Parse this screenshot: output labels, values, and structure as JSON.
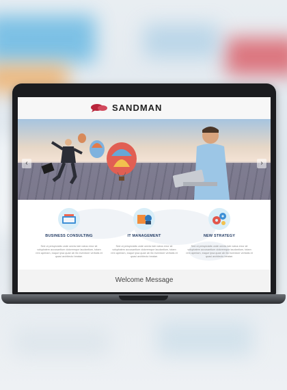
{
  "site": {
    "brand": "SANDMAN",
    "hero": {
      "prev_arrow": "‹",
      "next_arrow": "›"
    },
    "features": [
      {
        "title": "BUSINESS CONSULTING",
        "text": "Sed ut perspiciatis unde omnis iste natus error sit voluptatem accusantium doloremque laudantium, totam rem aperiam, eaque ipsa quae ab illo inventore veritatis et quasi architecto beatae."
      },
      {
        "title": "IT MANAGEMENT",
        "text": "Sed ut perspiciatis unde omnis iste natus error sit voluptatem accusantium doloremque laudantium, totam rem aperiam, eaque ipsa quae ab illo inventore veritatis et quasi architecto beatae."
      },
      {
        "title": "NEW STRATEGY",
        "text": "Sed ut perspiciatis unde omnis iste natus error sit voluptatem accusantium doloremque laudantium, totam rem aperiam, eaque ipsa quae ab illo inventore veritatis et quasi architecto beatae."
      }
    ],
    "welcome": "Welcome Message"
  },
  "colors": {
    "brand_red": "#b8243a",
    "title_navy": "#213a63",
    "icon_bg": "#d9eef8"
  }
}
